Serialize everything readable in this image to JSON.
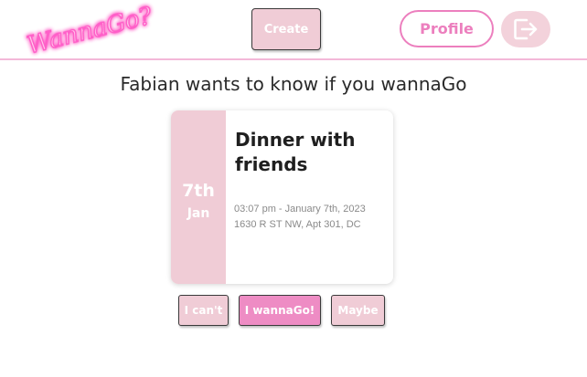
{
  "header": {
    "logo_text": "WannaGo?",
    "create_label": "Create",
    "profile_label": "Profile",
    "logout_icon": "logout-icon"
  },
  "prompt": "Fabian wants to know if you wannaGo",
  "event": {
    "day": "7th",
    "month": "Jan",
    "title": "Dinner with friends",
    "time": "03:07 pm - January 7th, 2023",
    "location": "1630 R ST NW, Apt 301, DC"
  },
  "rsvp": {
    "cant_label": "I can't",
    "go_label": "I wannaGo!",
    "maybe_label": "Maybe"
  },
  "colors": {
    "accent_pink": "#ec7fbe",
    "light_pink": "#f0ccd6",
    "logo_glow": "#ff5fc8"
  }
}
